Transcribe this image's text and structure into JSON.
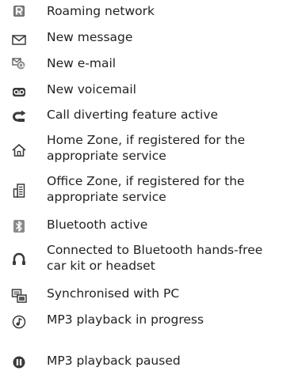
{
  "legend": {
    "items": [
      {
        "icon": "roaming-icon",
        "label": "Roaming network",
        "label_line2": ""
      },
      {
        "icon": "envelope-icon",
        "label": "New message",
        "label_line2": ""
      },
      {
        "icon": "email-icon",
        "label": "New e-mail",
        "label_line2": ""
      },
      {
        "icon": "voicemail-icon",
        "label": "New voicemail",
        "label_line2": ""
      },
      {
        "icon": "call-divert-icon",
        "label": "Call diverting feature active",
        "label_line2": ""
      },
      {
        "icon": "home-zone-icon",
        "label": "Home Zone, if registered for the",
        "label_line2": "appropriate service"
      },
      {
        "icon": "office-zone-icon",
        "label": "Office Zone, if registered for the",
        "label_line2": "appropriate service"
      },
      {
        "icon": "bluetooth-icon",
        "label": "Bluetooth active",
        "label_line2": ""
      },
      {
        "icon": "headset-icon",
        "label": "Connected to Bluetooth hands-free",
        "label_line2": "car kit or headset"
      },
      {
        "icon": "pc-sync-icon",
        "label": "Synchronised with PC",
        "label_line2": ""
      },
      {
        "icon": "mp3-play-icon",
        "label": "MP3 playback in progress",
        "label_line2": ""
      },
      {
        "icon": "mp3-pause-icon",
        "label": "MP3 playback paused",
        "label_line2": ""
      }
    ]
  },
  "colors": {
    "text": "#222222",
    "icon_dark": "#3a3a3a",
    "icon_mid": "#707070",
    "icon_light": "#bdbdbd"
  }
}
